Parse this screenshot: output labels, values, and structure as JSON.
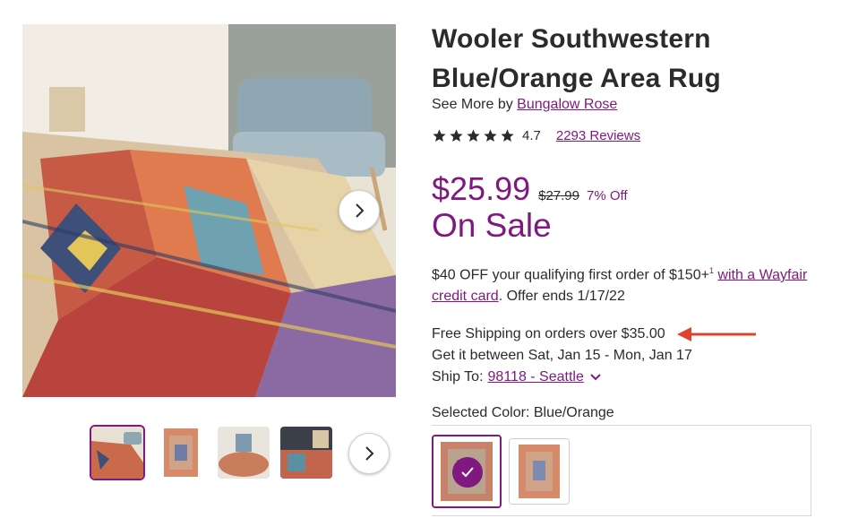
{
  "product": {
    "title": "Wooler Southwestern Blue/Orange Area Rug",
    "see_more_prefix": "See More by",
    "brand": "Bungalow Rose",
    "rating": "4.7",
    "reviews": "2293 Reviews",
    "stars_filled": 5
  },
  "pricing": {
    "price": "$25.99",
    "was_price": "$27.99",
    "discount": "7% Off",
    "sale_label": "On Sale"
  },
  "offer": {
    "text": "$40 OFF your qualifying first order of $150+",
    "superscript": "1",
    "link": "with a Wayfair credit card",
    "suffix": ". Offer ends 1/17/22"
  },
  "shipping": {
    "free_shipping": "Free Shipping on orders over $35.00",
    "delivery": "Get it between Sat, Jan 15 - Mon, Jan 17",
    "ship_to_label": "Ship To:",
    "ship_to_value": "98118 - Seattle"
  },
  "options": {
    "selected_color_label": "Selected Color: Blue/Orange"
  },
  "icons": {
    "next": "chevron-right-icon",
    "star": "star-icon",
    "check": "check-icon",
    "annotation": "arrow-left-icon",
    "dropdown": "chevron-down-icon"
  },
  "colors": {
    "accent": "#7f187f",
    "annotation_arrow": "#e0432b",
    "text": "#2b2b2b"
  }
}
